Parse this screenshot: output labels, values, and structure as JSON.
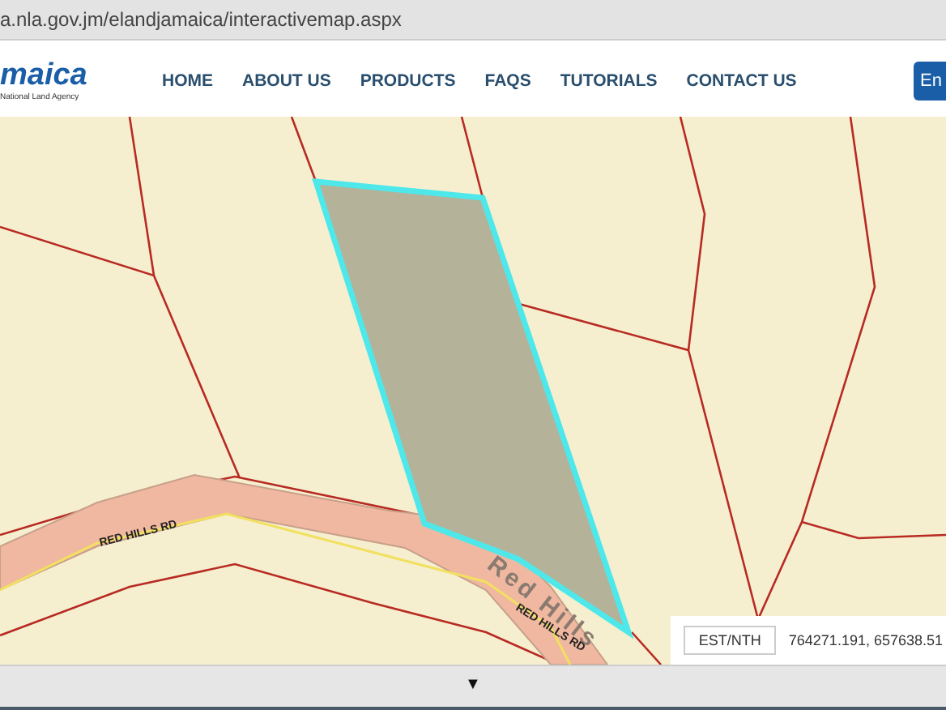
{
  "address_bar": {
    "url": "a.nla.gov.jm/elandjamaica/interactivemap.aspx"
  },
  "header": {
    "logo": {
      "name": "maica",
      "tagline": "National Land Agency"
    },
    "nav": [
      "HOME",
      "ABOUT US",
      "PRODUCTS",
      "FAQS",
      "TUTORIALS",
      "CONTACT US"
    ],
    "button": "En"
  },
  "map": {
    "road_labels": [
      "RED HILLS RD",
      "RED HILLS RD"
    ],
    "area_label": "Red Hills",
    "coordinates": {
      "label": "EST/NTH",
      "value": "764271.191, 657638.51"
    }
  },
  "bottom_bar": {
    "toggle": "▼"
  }
}
